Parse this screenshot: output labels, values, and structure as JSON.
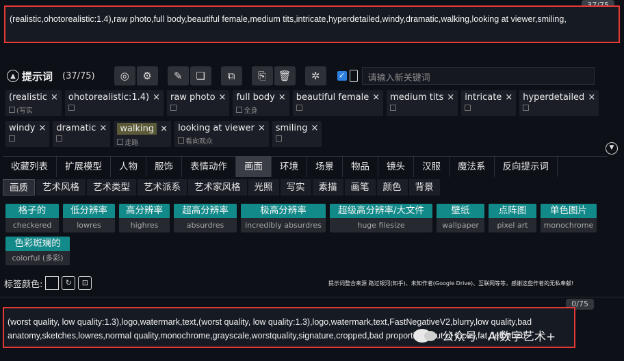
{
  "positive_prompt": {
    "text": "(realistic,ohotorealistic:1.4),raw photo,full body,beautiful female,medium tits,intricate,hyperdetailed,windy,dramatic,walking,looking at viewer,smiling,",
    "counter": "37/75"
  },
  "header": {
    "title": "提示词",
    "count": "(37/75)",
    "keyword_placeholder": "请输入新关键词",
    "toolbar_icons": [
      "globe-icon",
      "gear-icon",
      "edit-icon",
      "bookmark-icon",
      "split-icon",
      "copy-icon",
      "trash-icon",
      "settings-icon"
    ]
  },
  "tags": {
    "row1": [
      {
        "label": "(realistic",
        "sub": "(写实"
      },
      {
        "label": "ohotorealistic:1.4)",
        "sub": ""
      },
      {
        "label": "raw photo",
        "sub": ""
      },
      {
        "label": "full body",
        "sub": "全身"
      },
      {
        "label": "beautiful female",
        "sub": ""
      },
      {
        "label": "medium tits",
        "sub": ""
      },
      {
        "label": "intricate",
        "sub": ""
      },
      {
        "label": "hyperdetailed",
        "sub": ""
      }
    ],
    "row2": [
      {
        "label": "windy",
        "sub": ""
      },
      {
        "label": "dramatic",
        "sub": ""
      },
      {
        "label": "walking",
        "sub": "走路",
        "highlight": true
      },
      {
        "label": "looking at viewer",
        "sub": "看向观众"
      },
      {
        "label": "smiling",
        "sub": ""
      }
    ]
  },
  "category_tabs": [
    "收藏列表",
    "扩展模型",
    "人物",
    "服饰",
    "表情动作",
    "画面",
    "环境",
    "场景",
    "物品",
    "镜头",
    "汉服",
    "魔法系",
    "反向提示词"
  ],
  "active_category": "画面",
  "sub_tabs": [
    "画质",
    "艺术风格",
    "艺术类型",
    "艺术派系",
    "艺术家风格",
    "光照",
    "写实",
    "素描",
    "画笔",
    "颜色",
    "背景"
  ],
  "active_sub": "画质",
  "prompt_buttons": {
    "row1": [
      {
        "cn": "格子的",
        "en": "checkered"
      },
      {
        "cn": "低分辨率",
        "en": "lowres"
      },
      {
        "cn": "高分辨率",
        "en": "highres"
      },
      {
        "cn": "超高分辨率",
        "en": "absurdres"
      },
      {
        "cn": "极高分辨率",
        "en": "incredibly absurdres"
      },
      {
        "cn": "超级高分辨率/大文件",
        "en": "huge filesize"
      },
      {
        "cn": "壁纸",
        "en": "wallpaper"
      },
      {
        "cn": "点阵图",
        "en": "pixel art"
      },
      {
        "cn": "单色图片",
        "en": "monochrome"
      }
    ],
    "row2": [
      {
        "cn": "色彩斑斓的",
        "en": "colorful (多彩)"
      }
    ]
  },
  "tag_color": {
    "label": "标签颜色:",
    "credits": "提示词整合来源 路过银河(知乎)、未知作者(Google Drive)、互联网等等，感谢这些作者的无私奉献!"
  },
  "negative_prompt": {
    "text": "(worst quality, low quality:1.3),logo,watermark,text,(worst quality, low quality:1.3),logo,watermark,text,FastNegativeV2,blurry,low quality,bad anatomy,sketches,lowres,normal quality,monochrome,grayscale,worstquality,signature,cropped,bad proportions,out of focus,fat,deformed",
    "counter": "0/75"
  },
  "watermark": "公众号 · AI数字艺术+"
}
